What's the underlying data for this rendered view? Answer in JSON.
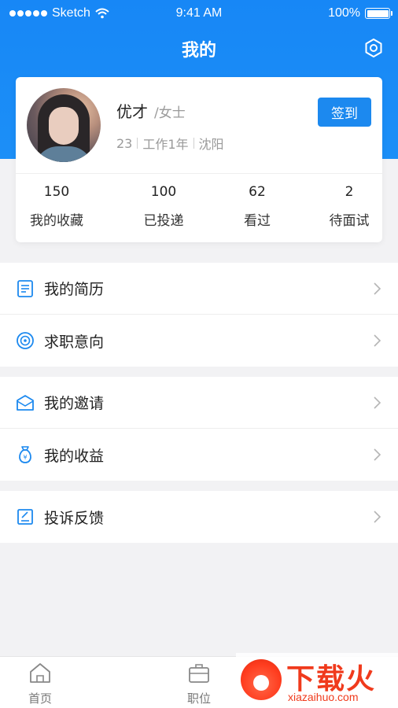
{
  "status_bar": {
    "carrier": "Sketch",
    "time": "9:41 AM",
    "battery": "100%"
  },
  "nav": {
    "title": "我的",
    "settings_icon": "gear-icon"
  },
  "profile": {
    "name": "优才",
    "gender": "/女士",
    "age": "23",
    "experience": "工作1年",
    "city": "沈阳",
    "checkin_label": "签到"
  },
  "stats": [
    {
      "value": "150",
      "label": "我的收藏"
    },
    {
      "value": "100",
      "label": "已投递"
    },
    {
      "value": "62",
      "label": "看过"
    },
    {
      "value": "2",
      "label": "待面试"
    }
  ],
  "menu": {
    "resume": "我的简历",
    "intention": "求职意向",
    "invitation": "我的邀请",
    "earnings": "我的收益",
    "feedback": "投诉反馈"
  },
  "tabbar": {
    "home": "首页",
    "jobs": "职位"
  },
  "watermark": {
    "title": "下载火",
    "subtitle": "xiazaihuo.com"
  },
  "colors": {
    "accent": "#1c89ef",
    "header": "#1787f6",
    "watermark": "#f03a1c"
  }
}
